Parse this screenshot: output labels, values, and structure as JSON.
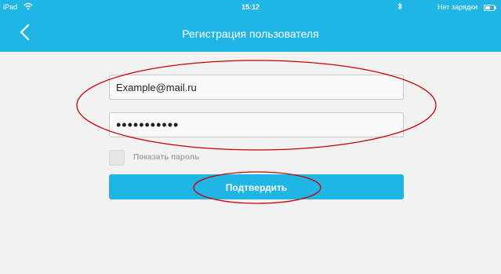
{
  "status_bar": {
    "device": "iPad",
    "time": "15:12",
    "battery_text": "Нет зарядки"
  },
  "nav": {
    "title": "Регистрация пользователя",
    "back_icon": "chevron-left-icon"
  },
  "form": {
    "email_value": "Example@mail.ru",
    "password_value": "•••••••••••",
    "show_password_label": "Показать пароль",
    "show_password_checked": false,
    "submit_label": "Подтвердить"
  },
  "colors": {
    "brand": "#1fb6e6",
    "annotation": "#cc0000"
  }
}
